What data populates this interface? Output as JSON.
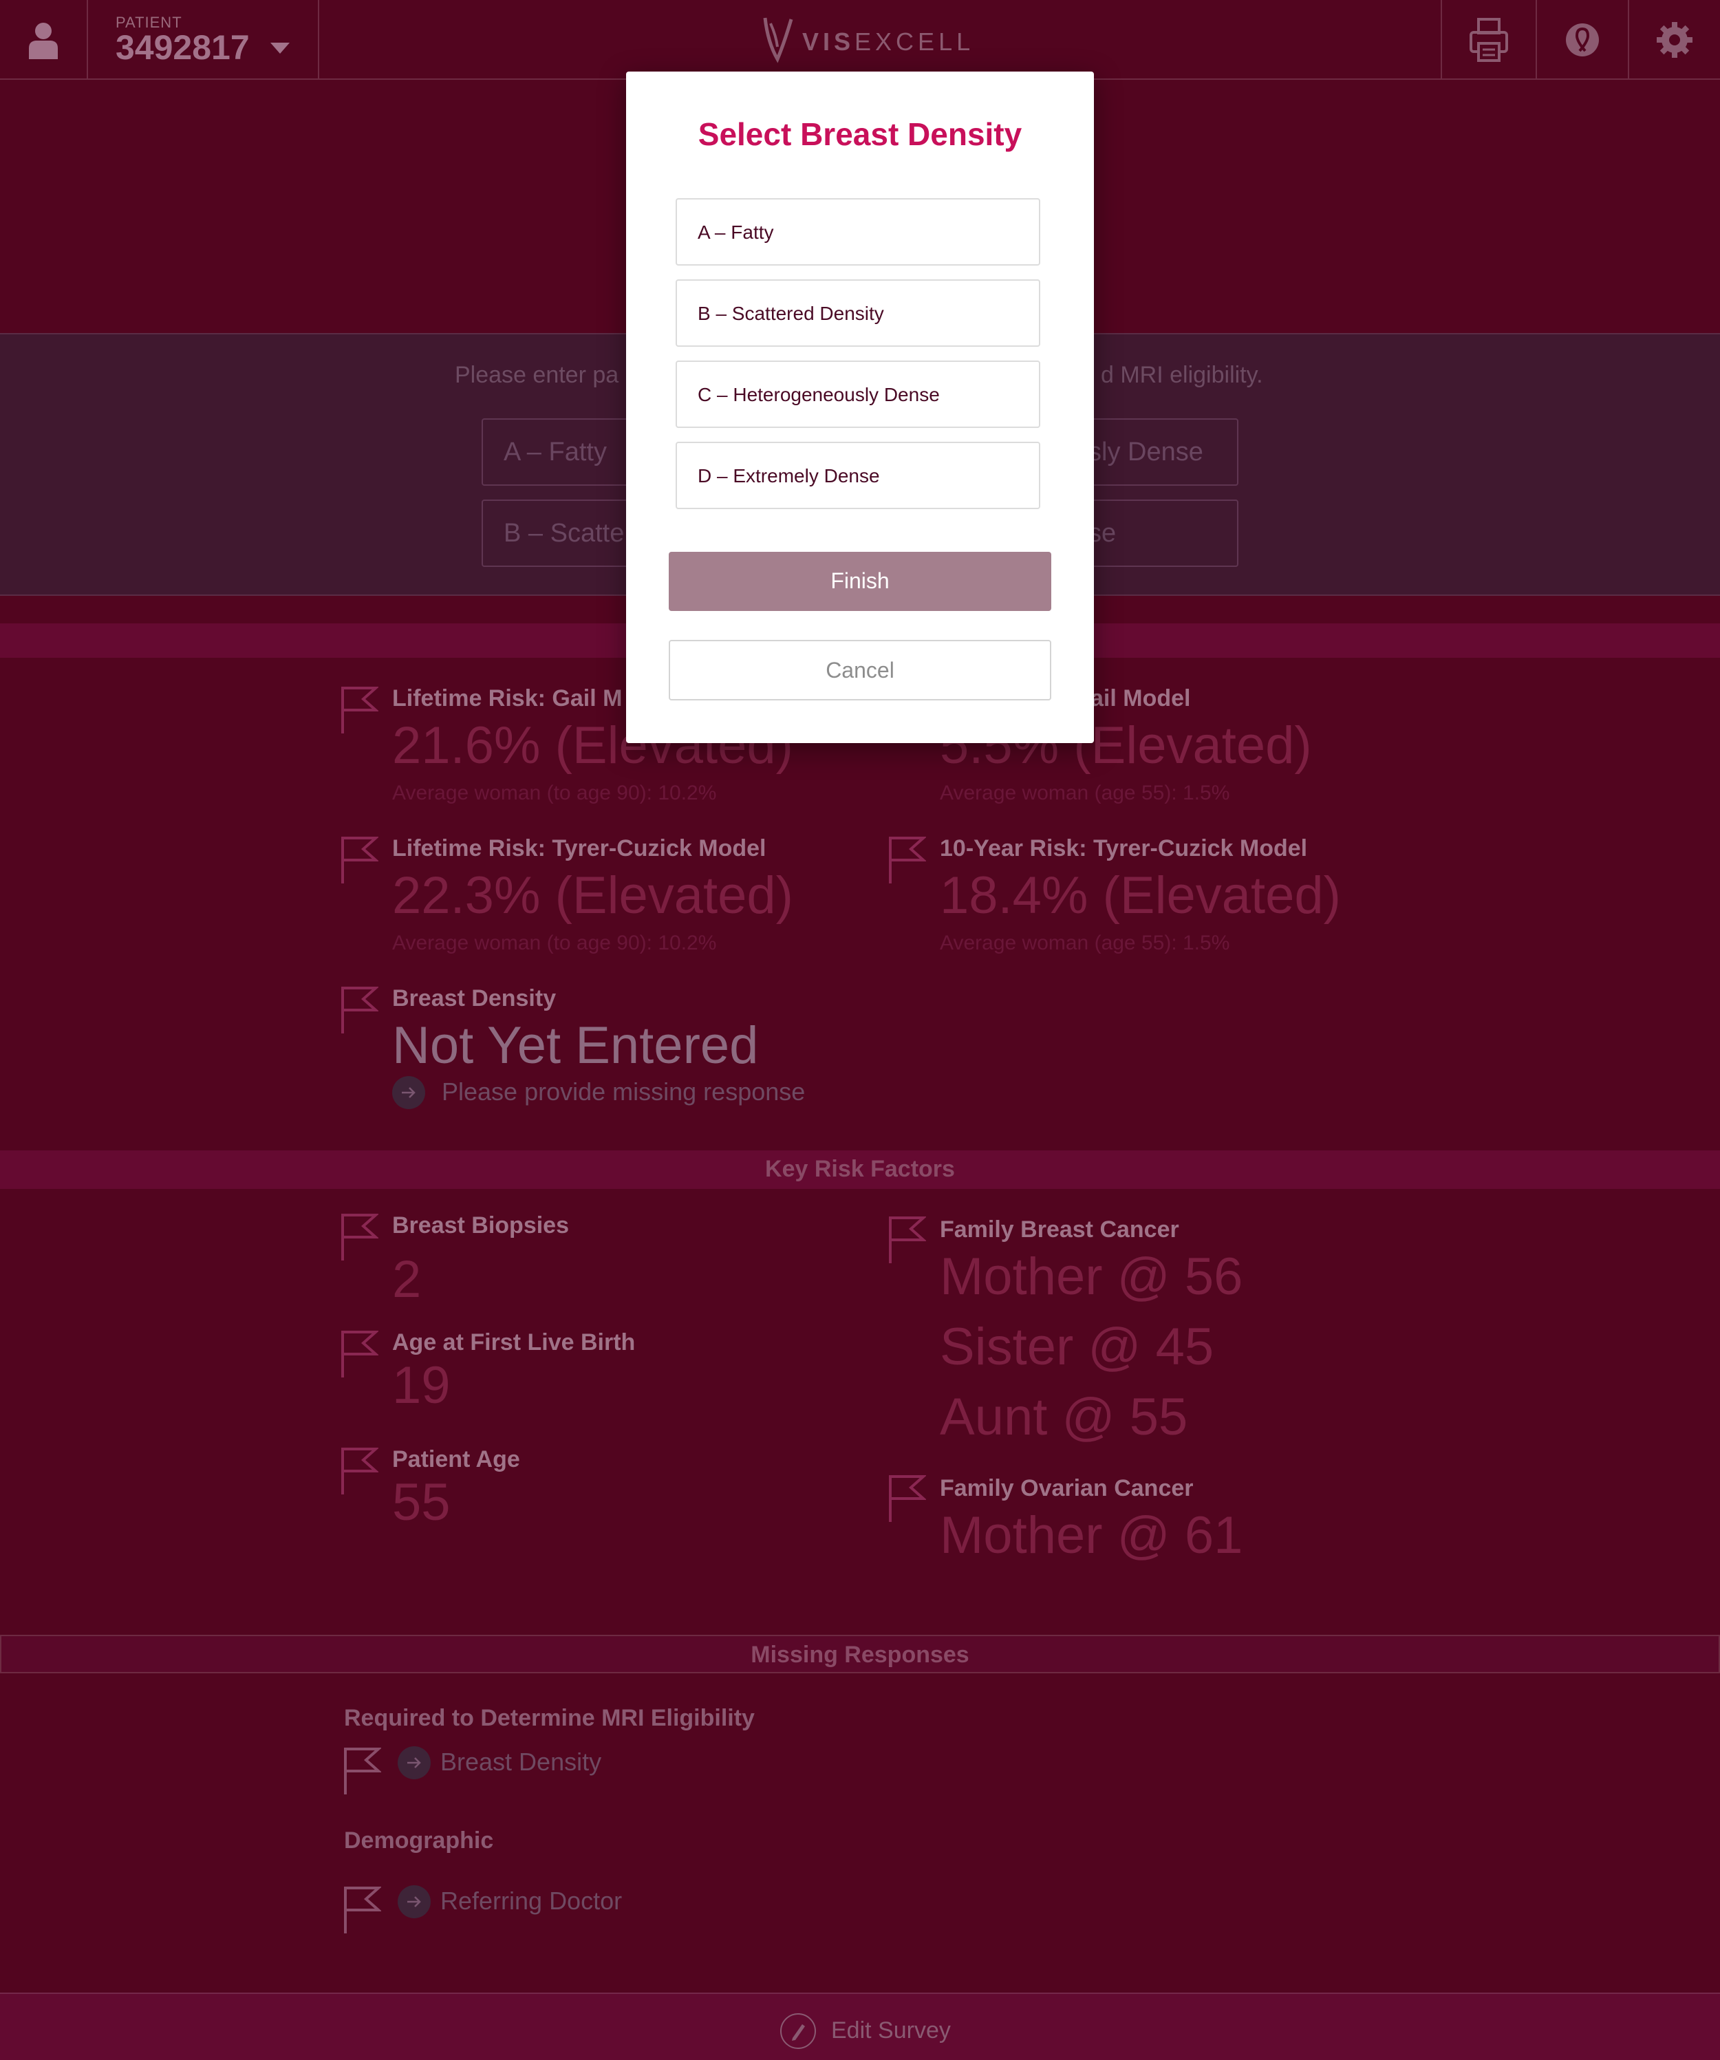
{
  "header": {
    "patient_label": "PATIENT",
    "patient_id": "3492817",
    "logo_strong": "VIS",
    "logo_light": "EXCELL"
  },
  "density_prompt": {
    "text_left": "Please enter pa",
    "text_right": "d MRI eligibility.",
    "options_visible": [
      "A – Fatty",
      "sly Dense",
      "B – Scatter",
      "se"
    ]
  },
  "risk": {
    "items": [
      {
        "title": "Lifetime Risk: Gail M",
        "value": "21.6% (Elevated)",
        "sub": "Average woman (to age 90): 10.2%"
      },
      {
        "title": "ail Model",
        "value": "5.5% (Elevated)",
        "sub": "Average woman (age 55): 1.5%"
      },
      {
        "title": "Lifetime Risk: Tyrer-Cuzick Model",
        "value": "22.3% (Elevated)",
        "sub": "Average woman (to age 90): 10.2%"
      },
      {
        "title": "10-Year Risk: Tyrer-Cuzick Model",
        "value": "18.4% (Elevated)",
        "sub": "Average woman (age 55): 1.5%"
      }
    ],
    "density_title": "Breast Density",
    "density_value": "Not Yet Entered",
    "density_hint": "Please provide missing response"
  },
  "key_factors": {
    "title": "Key Risk Factors",
    "biopsies_title": "Breast Biopsies",
    "biopsies_value": "2",
    "birth_title": "Age at First Live Birth",
    "birth_value": "19",
    "age_title": "Patient Age",
    "age_value": "55",
    "family_breast_title": "Family Breast Cancer",
    "family_breast_values": [
      "Mother @ 56",
      "Sister @ 45",
      "Aunt @ 55"
    ],
    "family_ovarian_title": "Family Ovarian Cancer",
    "family_ovarian_value": "Mother @ 61"
  },
  "missing": {
    "title": "Missing Responses",
    "required_title": "Required to Determine MRI Eligibility",
    "required_item": "Breast Density",
    "demographic_title": "Demographic",
    "demographic_item": "Referring Doctor"
  },
  "footer": {
    "edit_label": "Edit Survey"
  },
  "modal": {
    "title": "Select Breast Density",
    "options": [
      "A – Fatty",
      "B – Scattered Density",
      "C – Heterogeneously Dense",
      "D – Extremely Dense"
    ],
    "finish_label": "Finish",
    "cancel_label": "Cancel"
  },
  "colors": {
    "background": "#52051f",
    "accent": "#c8105a",
    "finish_disabled": "#a47f8d"
  },
  "icons": [
    "user-icon",
    "chevron-down-icon",
    "logo-icon",
    "printer-icon",
    "ribbon-icon",
    "gear-icon",
    "flag-icon",
    "arrow-right-icon",
    "pencil-icon"
  ]
}
